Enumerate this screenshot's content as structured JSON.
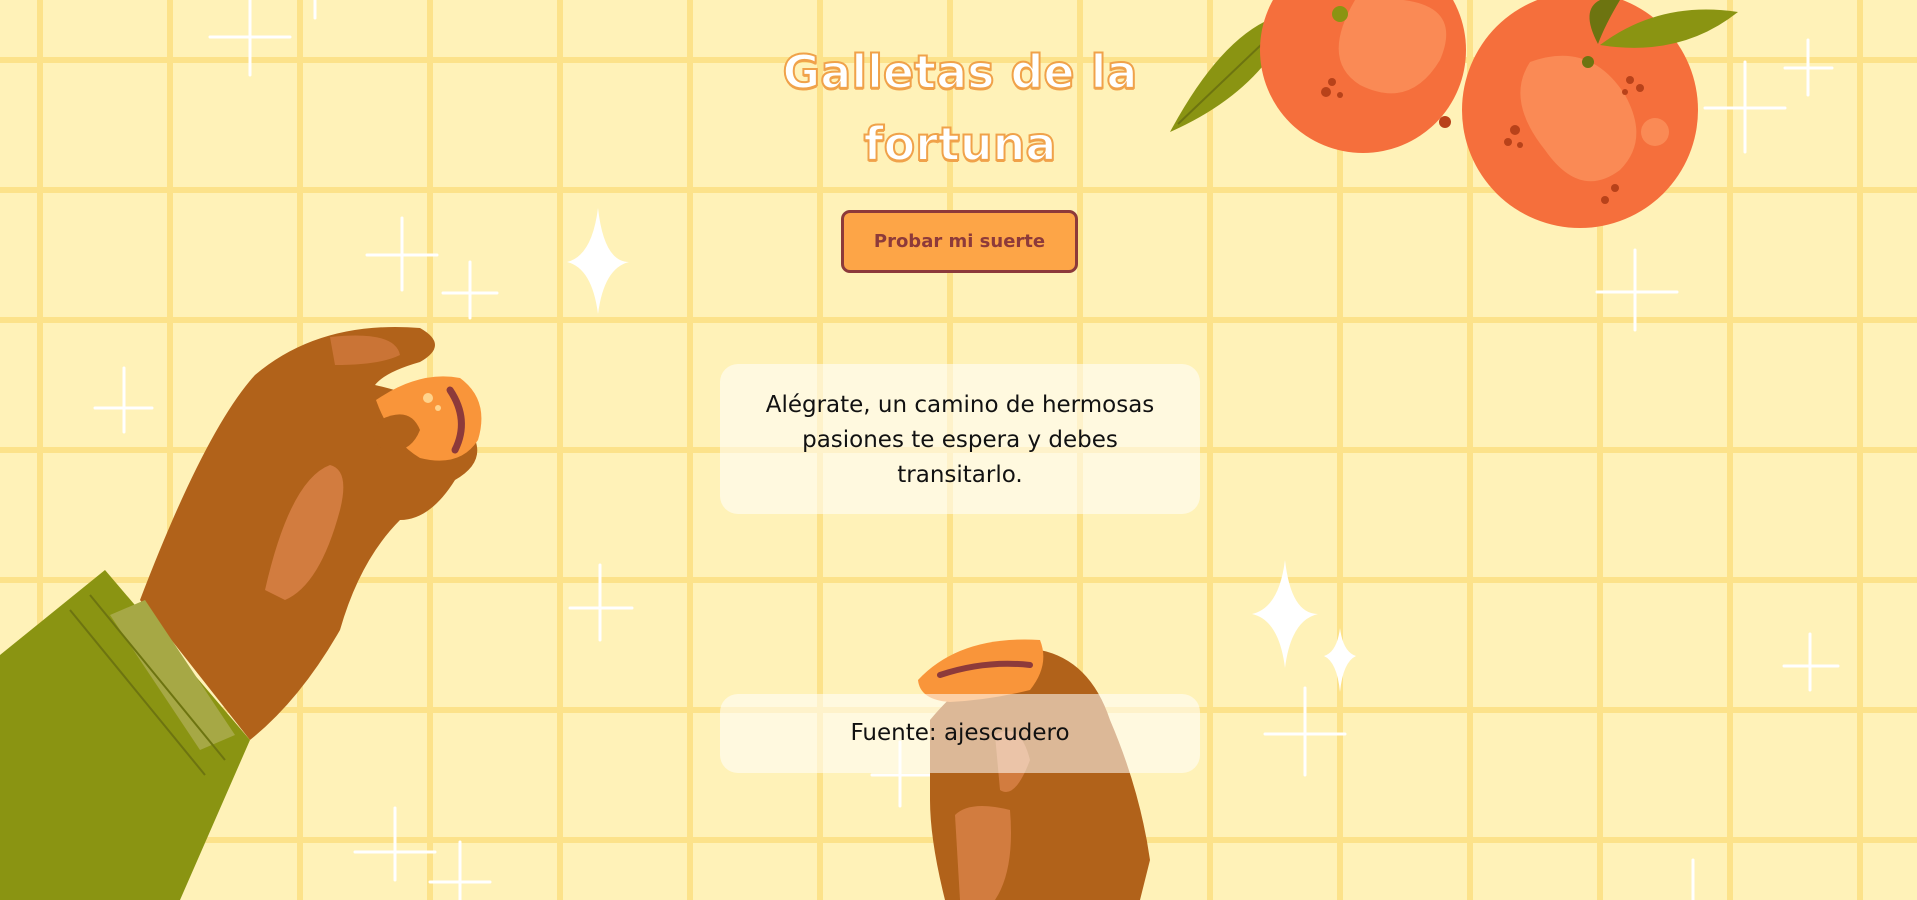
{
  "page": {
    "title": "Galletas de la fortuna",
    "button_label": "Probar mi suerte",
    "fortune_text": "Alégrate, un camino de hermosas pasiones te espera y debes transitarlo.",
    "source_text": "Fuente: ajescudero"
  },
  "colors": {
    "background": "#fff2b8",
    "grid": "#fce28a",
    "button_fill": "#fda547",
    "button_border": "#8d3a3a",
    "title_outline": "#f0a24a",
    "orange": "#f56f3c",
    "leaf": "#8a9412",
    "skin": "#b1621a",
    "sleeve": "#8a9412"
  },
  "icons": [
    "sparkle-icon",
    "orange-illustration",
    "hand-illustration",
    "cookie-illustration"
  ]
}
